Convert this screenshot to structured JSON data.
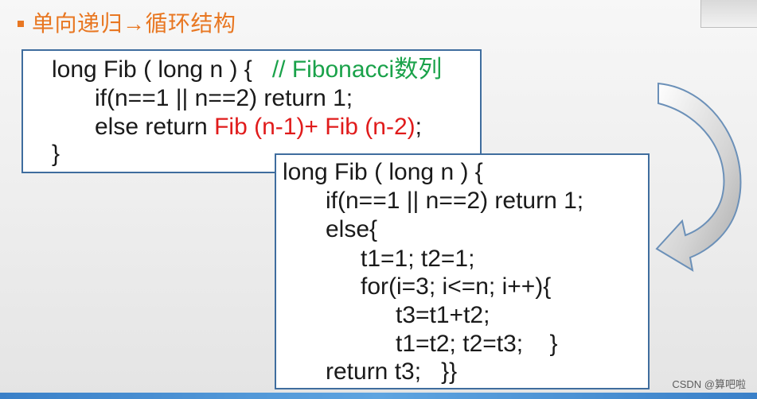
{
  "header": {
    "title": "单向递归→循环结构"
  },
  "box1": {
    "line1_code": "long Fib ( long n ) {   ",
    "line1_comment": "// Fibonacci数列",
    "line2": "if(n==1 || n==2) return 1;",
    "line3_pre": "else return ",
    "line3_red": "Fib (n-1)+ Fib (n-2)",
    "line3_post": ";",
    "line4": "}"
  },
  "box2": {
    "lines": [
      "long Fib ( long n ) {",
      "if(n==1 || n==2) return 1;",
      "else{",
      "t1=1; t2=1;",
      "for(i=3; i<=n; i++){",
      "t3=t1+t2;",
      "t1=t2; t2=t3;    }",
      "return t3;   }}"
    ]
  },
  "watermark": "CSDN @算吧啦",
  "colors": {
    "title": "#e87722",
    "border": "#3f6d9e",
    "comment": "#1aa24a",
    "highlight": "#e01b1b"
  },
  "icons": {
    "transition_arrow": "curved-arrow-icon"
  }
}
